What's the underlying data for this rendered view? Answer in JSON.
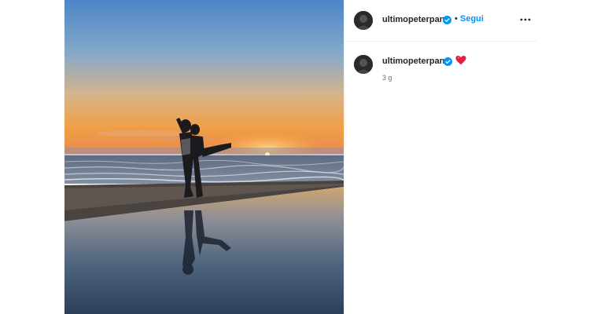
{
  "post": {
    "image_description_icon": "sunset-beach-photo",
    "header": {
      "username": "ultimopeterpan",
      "separator": "•",
      "follow_label": "Segui",
      "more_icon": "more-options-icon"
    },
    "caption": {
      "username": "ultimopeterpan",
      "emoji": "heart-icon",
      "timestamp": "3 g"
    }
  },
  "colors": {
    "follow_blue": "#0095f6",
    "verified_blue": "#0095f6",
    "heart_red": "#e41e3f",
    "secondary_text": "#737373",
    "divider": "#efefef"
  }
}
